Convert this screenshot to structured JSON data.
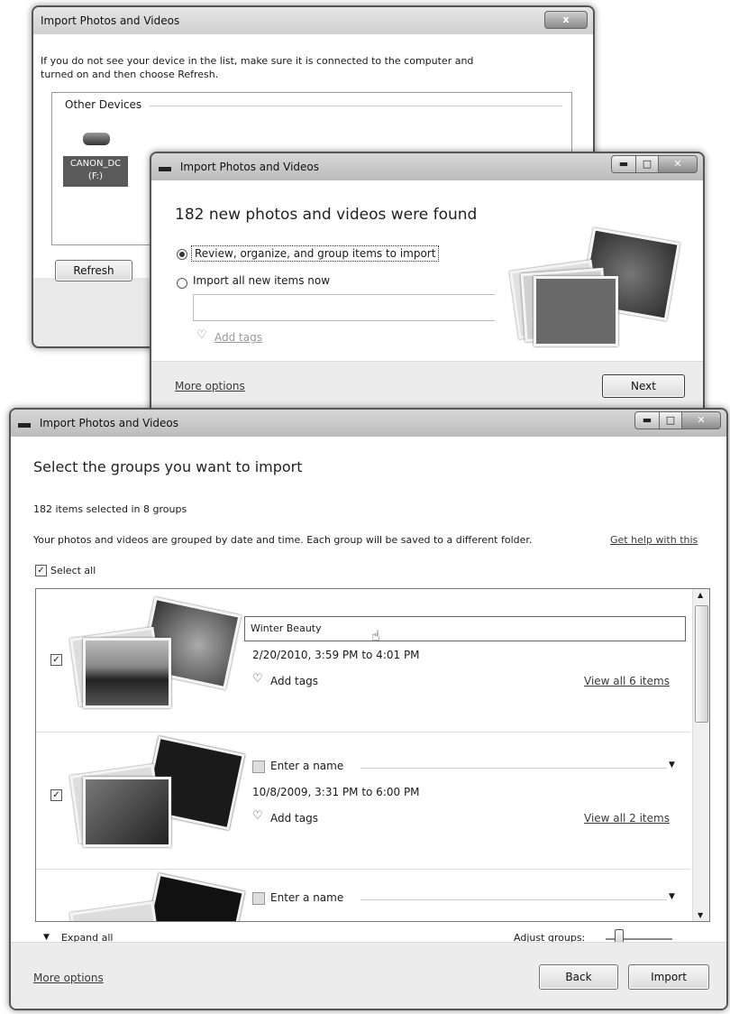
{
  "dialog1": {
    "title": "Import Photos and Videos",
    "instructions": "If you do not see your device in the list, make sure it is connected to the computer and turned on and then choose Refresh.",
    "group_label": "Other Devices",
    "device_name": "CANON_DC",
    "device_drive": "(F:)",
    "refresh_label": "Refresh",
    "close_glyph": "x"
  },
  "dialog2": {
    "title": "Import Photos and Videos",
    "heading": "182 new photos and videos were found",
    "option1": "Review, organize, and group items to import",
    "option2": "Import all new items now",
    "add_tags": "Add tags",
    "more_options": "More options",
    "next_label": "Next"
  },
  "dialog3": {
    "title": "Import Photos and Videos",
    "heading": "Select the groups you want to import",
    "selection_summary": "182 items selected in 8 groups",
    "description": "Your photos and videos are grouped by date and time. Each group will be saved to a different folder.",
    "help_link": "Get help with this",
    "select_all": "Select all",
    "groups": [
      {
        "name": "Winter Beauty",
        "date": "2/20/2010, 3:59 PM to 4:01 PM",
        "add_tags": "Add tags",
        "view_all": "View all 6 items"
      },
      {
        "name_placeholder": "Enter a name",
        "date": "10/8/2009, 3:31 PM to 6:00 PM",
        "add_tags": "Add tags",
        "view_all": "View all 2 items"
      },
      {
        "name_placeholder": "Enter a name"
      }
    ],
    "expand_all": "Expand all",
    "adjust_groups": "Adjust groups:",
    "more_options": "More options",
    "back_label": "Back",
    "import_label": "Import"
  }
}
